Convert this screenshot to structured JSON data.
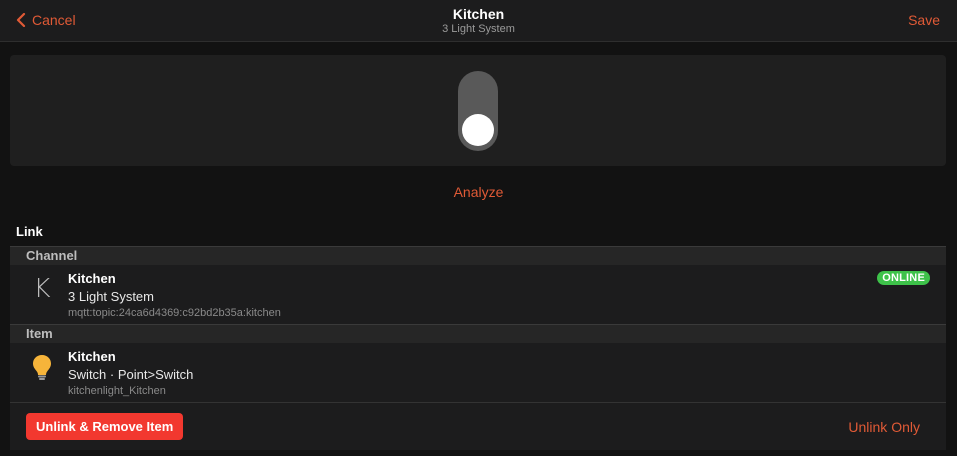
{
  "navbar": {
    "back_label": "Cancel",
    "title": "Kitchen",
    "subtitle": "3 Light System",
    "save_label": "Save"
  },
  "toggle": {
    "state": "off"
  },
  "analyze_label": "Analyze",
  "link_label": "Link",
  "channel": {
    "header": "Channel",
    "icon_letter": "K",
    "title": "Kitchen",
    "subtitle": "3 Light System",
    "uid": "mqtt:topic:24ca6d4369:c92bd2b35a:kitchen",
    "status": "ONLINE"
  },
  "item": {
    "header": "Item",
    "icon": "lightbulb-icon",
    "title": "Kitchen",
    "subtitle": "Switch · Point>Switch",
    "name": "kitchenlight_Kitchen"
  },
  "actions": {
    "unlink_remove_label": "Unlink & Remove Item",
    "unlink_only_label": "Unlink Only"
  },
  "colors": {
    "accent": "#e05a36",
    "danger": "#f2382f",
    "online": "#3ec24a"
  }
}
